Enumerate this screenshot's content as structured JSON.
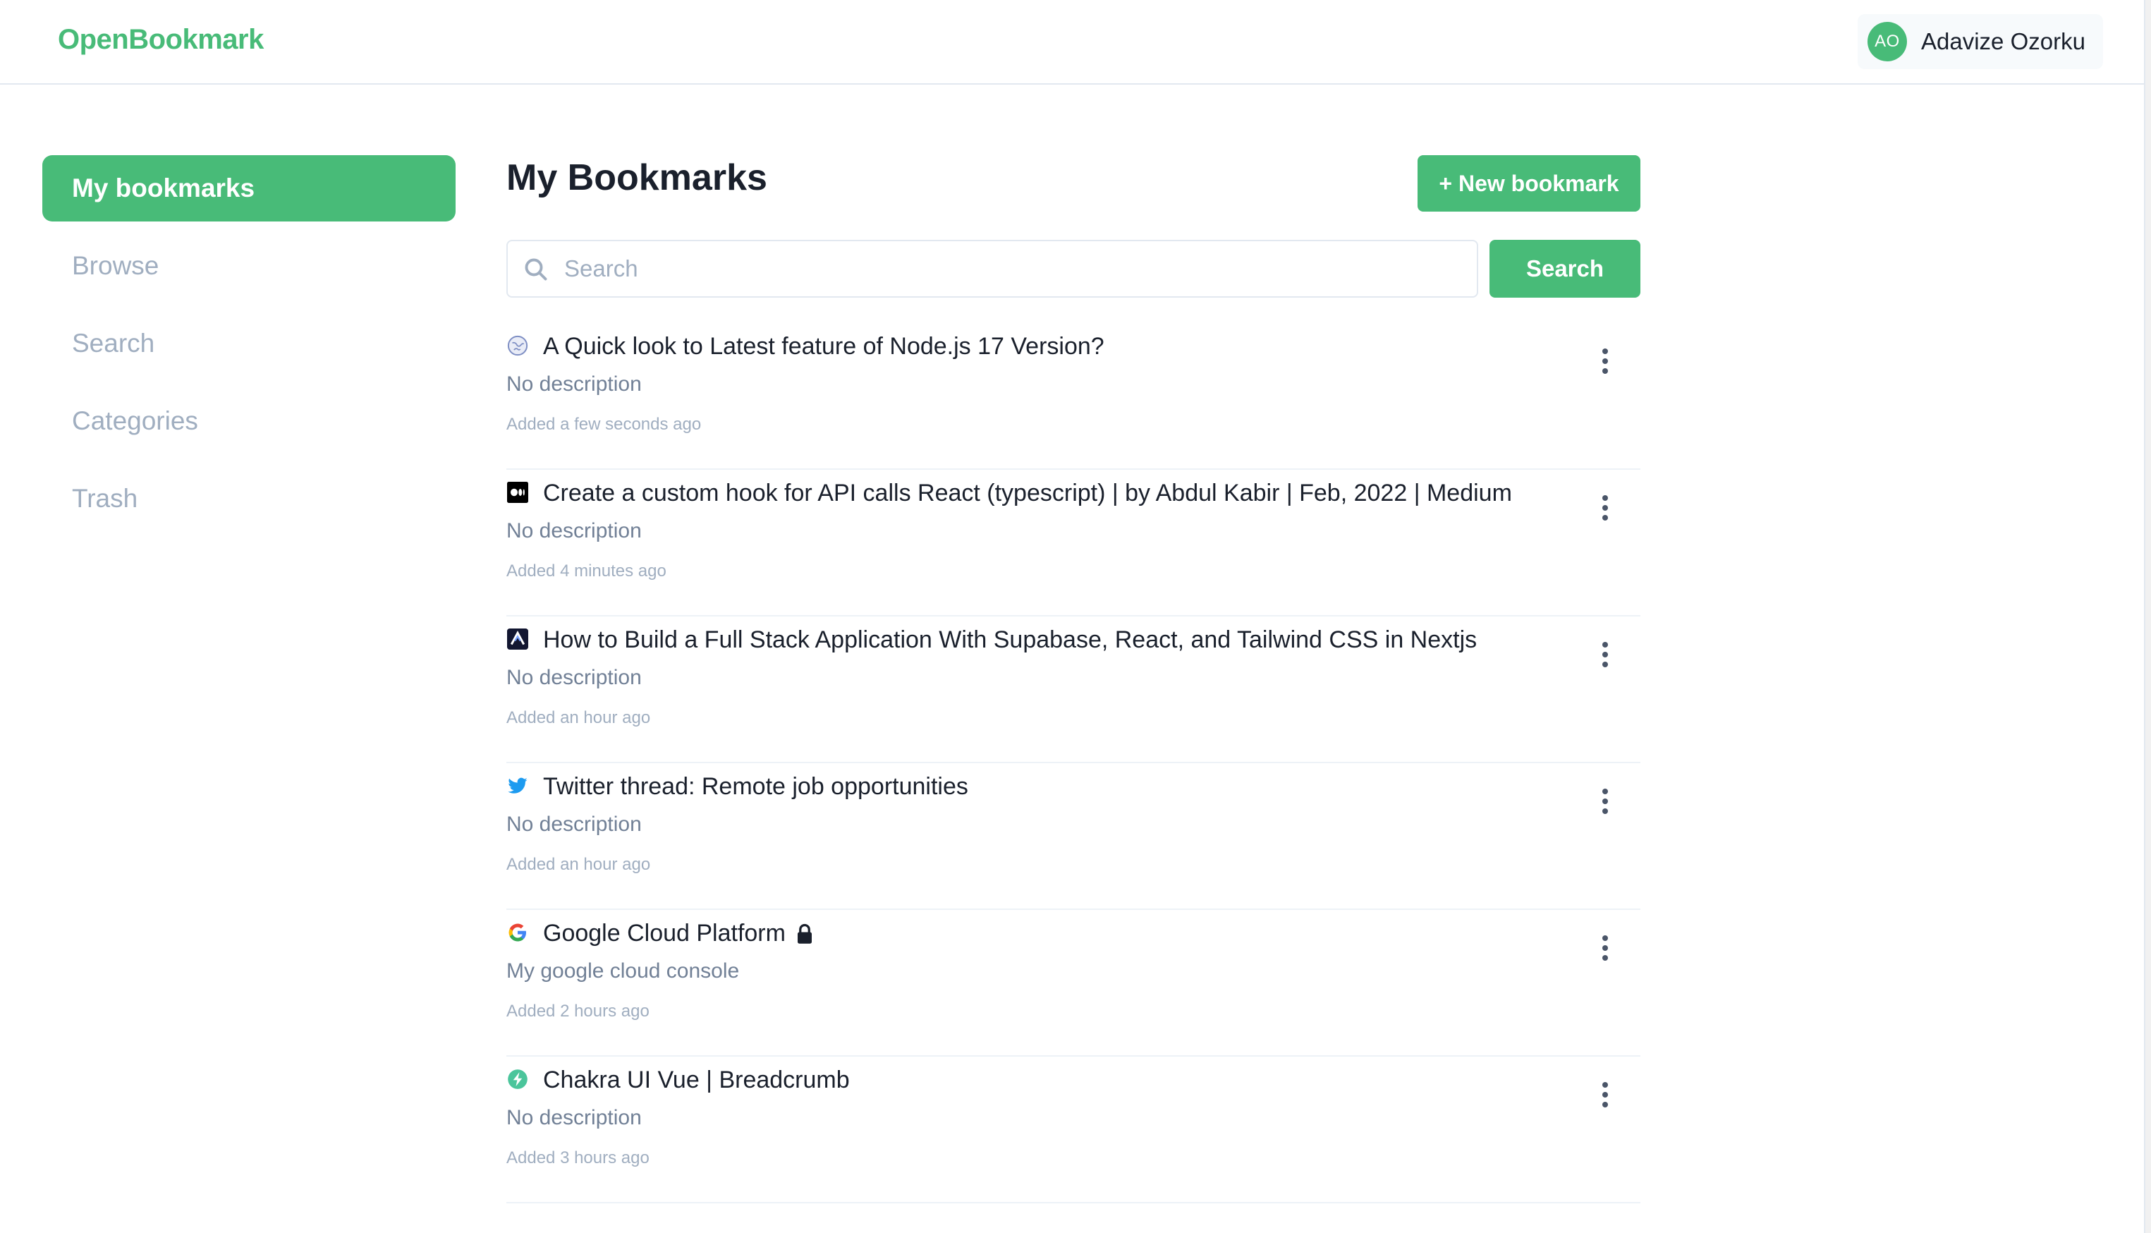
{
  "app": {
    "name": "OpenBookmark"
  },
  "user": {
    "initials": "AO",
    "name": "Adavize Ozorku"
  },
  "sidebar": {
    "items": [
      {
        "label": "My bookmarks",
        "active": true
      },
      {
        "label": "Browse"
      },
      {
        "label": "Search"
      },
      {
        "label": "Categories"
      },
      {
        "label": "Trash"
      }
    ]
  },
  "main": {
    "title": "My Bookmarks",
    "new_button": "+ New bookmark",
    "search": {
      "placeholder": "Search",
      "value": "",
      "button": "Search"
    }
  },
  "bookmarks": [
    {
      "title": "A Quick look to Latest feature of Node.js 17 Version?",
      "description": "No description",
      "added": "Added a few seconds ago",
      "icon": "globe-icon",
      "locked": false
    },
    {
      "title": "Create a custom hook for API calls React (typescript) | by Abdul Kabir | Feb, 2022 | Medium",
      "description": "No description",
      "added": "Added 4 minutes ago",
      "icon": "medium-icon",
      "locked": false
    },
    {
      "title": "How to Build a Full Stack Application With Supabase, React, and Tailwind CSS in Nextjs",
      "description": "No description",
      "added": "Added an hour ago",
      "icon": "site-favicon-icon",
      "locked": false
    },
    {
      "title": "Twitter thread: Remote job opportunities",
      "description": "No description",
      "added": "Added an hour ago",
      "icon": "twitter-icon",
      "locked": false
    },
    {
      "title": "Google Cloud Platform",
      "description": "My google cloud console",
      "added": "Added 2 hours ago",
      "icon": "google-icon",
      "locked": true
    },
    {
      "title": "Chakra UI Vue | Breadcrumb",
      "description": "No description",
      "added": "Added 3 hours ago",
      "icon": "chakra-icon",
      "locked": false
    }
  ],
  "colors": {
    "brand": "#48bb78",
    "text": "#1a202c",
    "muted": "#718096",
    "faint": "#a0aec0"
  }
}
